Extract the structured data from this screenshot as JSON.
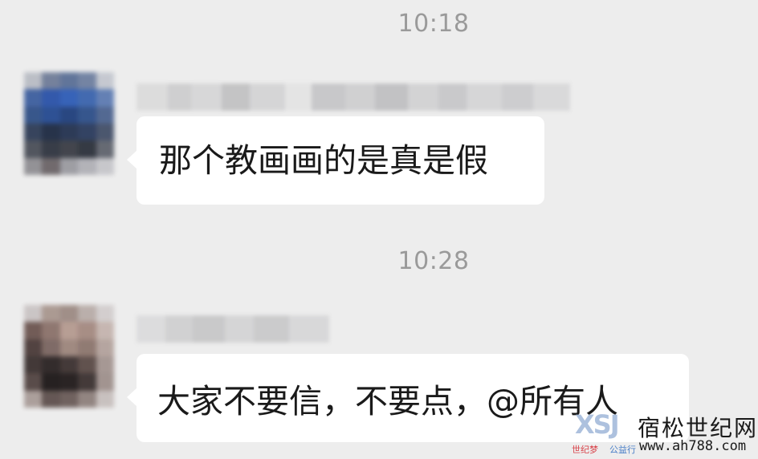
{
  "chat": {
    "messages": [
      {
        "time": "10:18",
        "text": "那个教画画的是真是假"
      },
      {
        "time": "10:28",
        "text": "大家不要信，不要点，@所有人"
      }
    ]
  },
  "watermark": {
    "logo_text": "XSJ",
    "sub_left": "世纪梦",
    "sub_right": "公益行",
    "site_name": "宿松世纪网",
    "site_url": "www.ah788.com"
  },
  "colors": {
    "background": "#ededed",
    "bubble": "#ffffff",
    "timestamp": "#9a9a9a",
    "text": "#1a1a1a"
  }
}
